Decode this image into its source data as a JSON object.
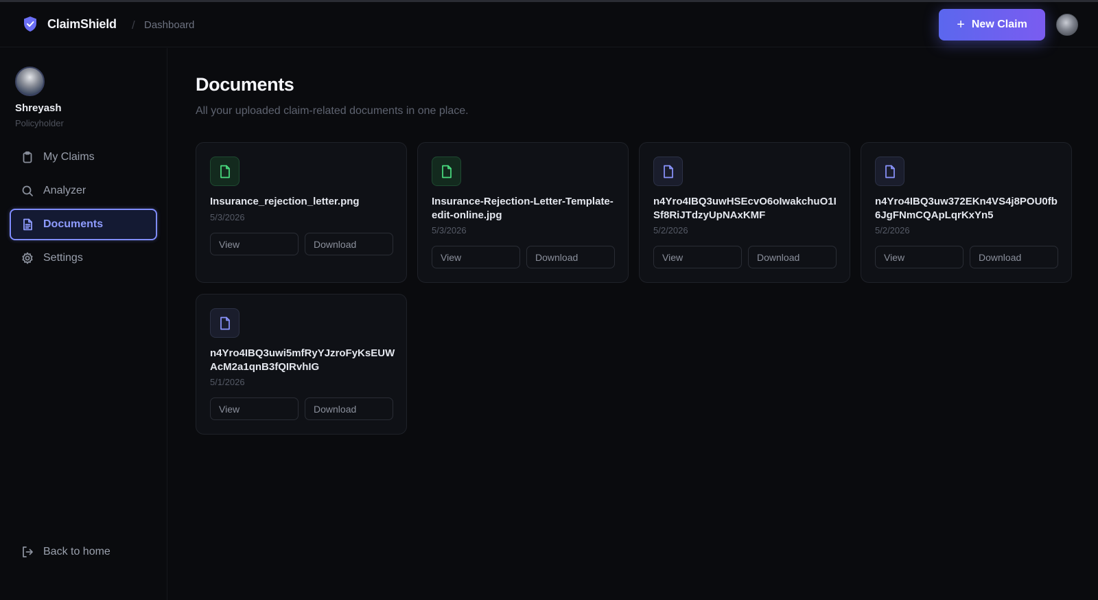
{
  "header": {
    "brand_name": "ClaimShield",
    "separator": "/",
    "breadcrumb": "Dashboard",
    "new_claim_plus": "+",
    "new_claim_label": "New Claim"
  },
  "user": {
    "name": "Shreyash",
    "role": "Policyholder"
  },
  "sidebar": {
    "items": [
      {
        "label": "My Claims",
        "icon": "clipboard-icon"
      },
      {
        "label": "Analyzer",
        "icon": "search-icon"
      },
      {
        "label": "Documents",
        "icon": "document-icon",
        "active": true
      },
      {
        "label": "Settings",
        "icon": "gear-icon"
      }
    ],
    "back_label": "Back to home"
  },
  "main": {
    "title": "Documents",
    "subtitle": "All your uploaded claim-related documents in one place.",
    "view_label": "View",
    "download_label": "Download",
    "documents": [
      {
        "name": "Insurance_rejection_letter.png",
        "date": "5/3/2026",
        "icon_color": "green"
      },
      {
        "name": "Insurance-Rejection-Letter-Template-edit-online.jpg",
        "date": "5/3/2026",
        "icon_color": "green"
      },
      {
        "name": "n4Yro4IBQ3uwHSEcvO6oIwakchuO1ISf8RiJTdzyUpNAxKMF",
        "date": "5/2/2026",
        "icon_color": "blue"
      },
      {
        "name": "n4Yro4IBQ3uw372EKn4VS4j8POU0fb6JgFNmCQApLqrKxYn5",
        "date": "5/2/2026",
        "icon_color": "blue"
      },
      {
        "name": "n4Yro4IBQ3uwi5mfRyYJzroFyKsEUWAcM2a1qnB3fQIRvhIG",
        "date": "5/1/2026",
        "icon_color": "blue"
      }
    ]
  },
  "colors": {
    "accent": "#7f8cff",
    "button_gradient_start": "#5b67ee",
    "button_gradient_end": "#7a5cf0",
    "image_file": "#4ade80",
    "generic_file": "#8b95ff"
  }
}
